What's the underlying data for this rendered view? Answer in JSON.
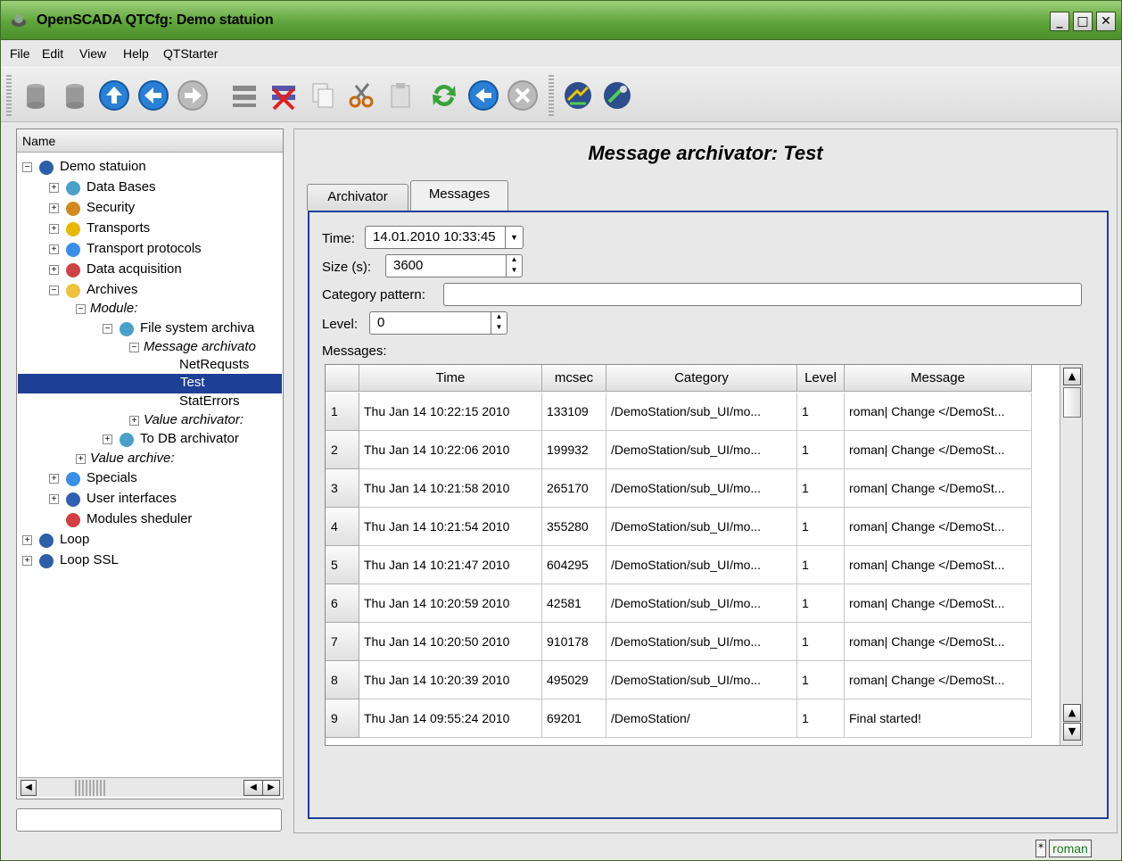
{
  "window": {
    "title": "OpenSCADA QTCfg: Demo statuion"
  },
  "menu": [
    "File",
    "Edit",
    "View",
    "Help",
    "QTStarter"
  ],
  "tree": {
    "header": "Name",
    "items": [
      {
        "label": "Demo statuion",
        "italic": false,
        "icon": "station-icon"
      },
      {
        "label": "Data Bases",
        "italic": false,
        "icon": "database-icon"
      },
      {
        "label": "Security",
        "italic": false,
        "icon": "security-icon"
      },
      {
        "label": "Transports",
        "italic": false,
        "icon": "lightning-icon"
      },
      {
        "label": "Transport protocols",
        "italic": false,
        "icon": "folder-icon"
      },
      {
        "label": "Data acquisition",
        "italic": false,
        "icon": "chart-icon"
      },
      {
        "label": "Archives",
        "italic": false,
        "icon": "archive-icon"
      },
      {
        "label": "Module:",
        "italic": true
      },
      {
        "label": "File system archiva",
        "italic": false,
        "icon": "filesystem-icon"
      },
      {
        "label": "Message archivato",
        "italic": true
      },
      {
        "label": "NetRequsts",
        "italic": false
      },
      {
        "label": "Test",
        "italic": false
      },
      {
        "label": "StatErrors",
        "italic": false
      },
      {
        "label": "Value archivator:",
        "italic": true
      },
      {
        "label": "To DB archivator",
        "italic": false,
        "icon": "database-icon"
      },
      {
        "label": "Value archive:",
        "italic": true
      },
      {
        "label": "Specials",
        "italic": false,
        "icon": "help-icon"
      },
      {
        "label": "User interfaces",
        "italic": false,
        "icon": "monitor-icon"
      },
      {
        "label": "Modules sheduler",
        "italic": false,
        "icon": "modules-icon"
      },
      {
        "label": "Loop",
        "italic": false,
        "icon": "station-icon"
      },
      {
        "label": "Loop SSL",
        "italic": false,
        "icon": "station-icon"
      }
    ]
  },
  "content": {
    "title": "Message archivator: Test",
    "tabs": [
      "Archivator",
      "Messages"
    ],
    "active_tab": "Messages",
    "time_label": "Time:",
    "time_value": "14.01.2010 10:33:45",
    "size_label": "Size (s):",
    "size_value": "3600",
    "category_label": "Category pattern:",
    "category_value": "",
    "level_label": "Level:",
    "level_value": "0",
    "messages_label": "Messages:",
    "columns": [
      "Time",
      "mcsec",
      "Category",
      "Level",
      "Message"
    ],
    "rows": [
      {
        "n": "1",
        "time": "Thu Jan 14 10:22:15 2010",
        "mcsec": "133109",
        "category": "/DemoStation/sub_UI/mo...",
        "level": "1",
        "message": "roman| Change </DemoSt..."
      },
      {
        "n": "2",
        "time": "Thu Jan 14 10:22:06 2010",
        "mcsec": "199932",
        "category": "/DemoStation/sub_UI/mo...",
        "level": "1",
        "message": "roman| Change </DemoSt..."
      },
      {
        "n": "3",
        "time": "Thu Jan 14 10:21:58 2010",
        "mcsec": "265170",
        "category": "/DemoStation/sub_UI/mo...",
        "level": "1",
        "message": "roman| Change </DemoSt..."
      },
      {
        "n": "4",
        "time": "Thu Jan 14 10:21:54 2010",
        "mcsec": "355280",
        "category": "/DemoStation/sub_UI/mo...",
        "level": "1",
        "message": "roman| Change </DemoSt..."
      },
      {
        "n": "5",
        "time": "Thu Jan 14 10:21:47 2010",
        "mcsec": "604295",
        "category": "/DemoStation/sub_UI/mo...",
        "level": "1",
        "message": "roman| Change </DemoSt..."
      },
      {
        "n": "6",
        "time": "Thu Jan 14 10:20:59 2010",
        "mcsec": "42581",
        "category": "/DemoStation/sub_UI/mo...",
        "level": "1",
        "message": "roman| Change </DemoSt..."
      },
      {
        "n": "7",
        "time": "Thu Jan 14 10:20:50 2010",
        "mcsec": "910178",
        "category": "/DemoStation/sub_UI/mo...",
        "level": "1",
        "message": "roman| Change </DemoSt..."
      },
      {
        "n": "8",
        "time": "Thu Jan 14 10:20:39 2010",
        "mcsec": "495029",
        "category": "/DemoStation/sub_UI/mo...",
        "level": "1",
        "message": "roman| Change </DemoSt..."
      },
      {
        "n": "9",
        "time": "Thu Jan 14 09:55:24 2010",
        "mcsec": "69201",
        "category": "/DemoStation/",
        "level": "1",
        "message": "Final started!"
      }
    ]
  },
  "status": {
    "star": "*",
    "user": "roman"
  },
  "colors": {
    "titlebar": "#5fa43c",
    "selection": "#1e3f96",
    "user": "#1e7a1e"
  }
}
